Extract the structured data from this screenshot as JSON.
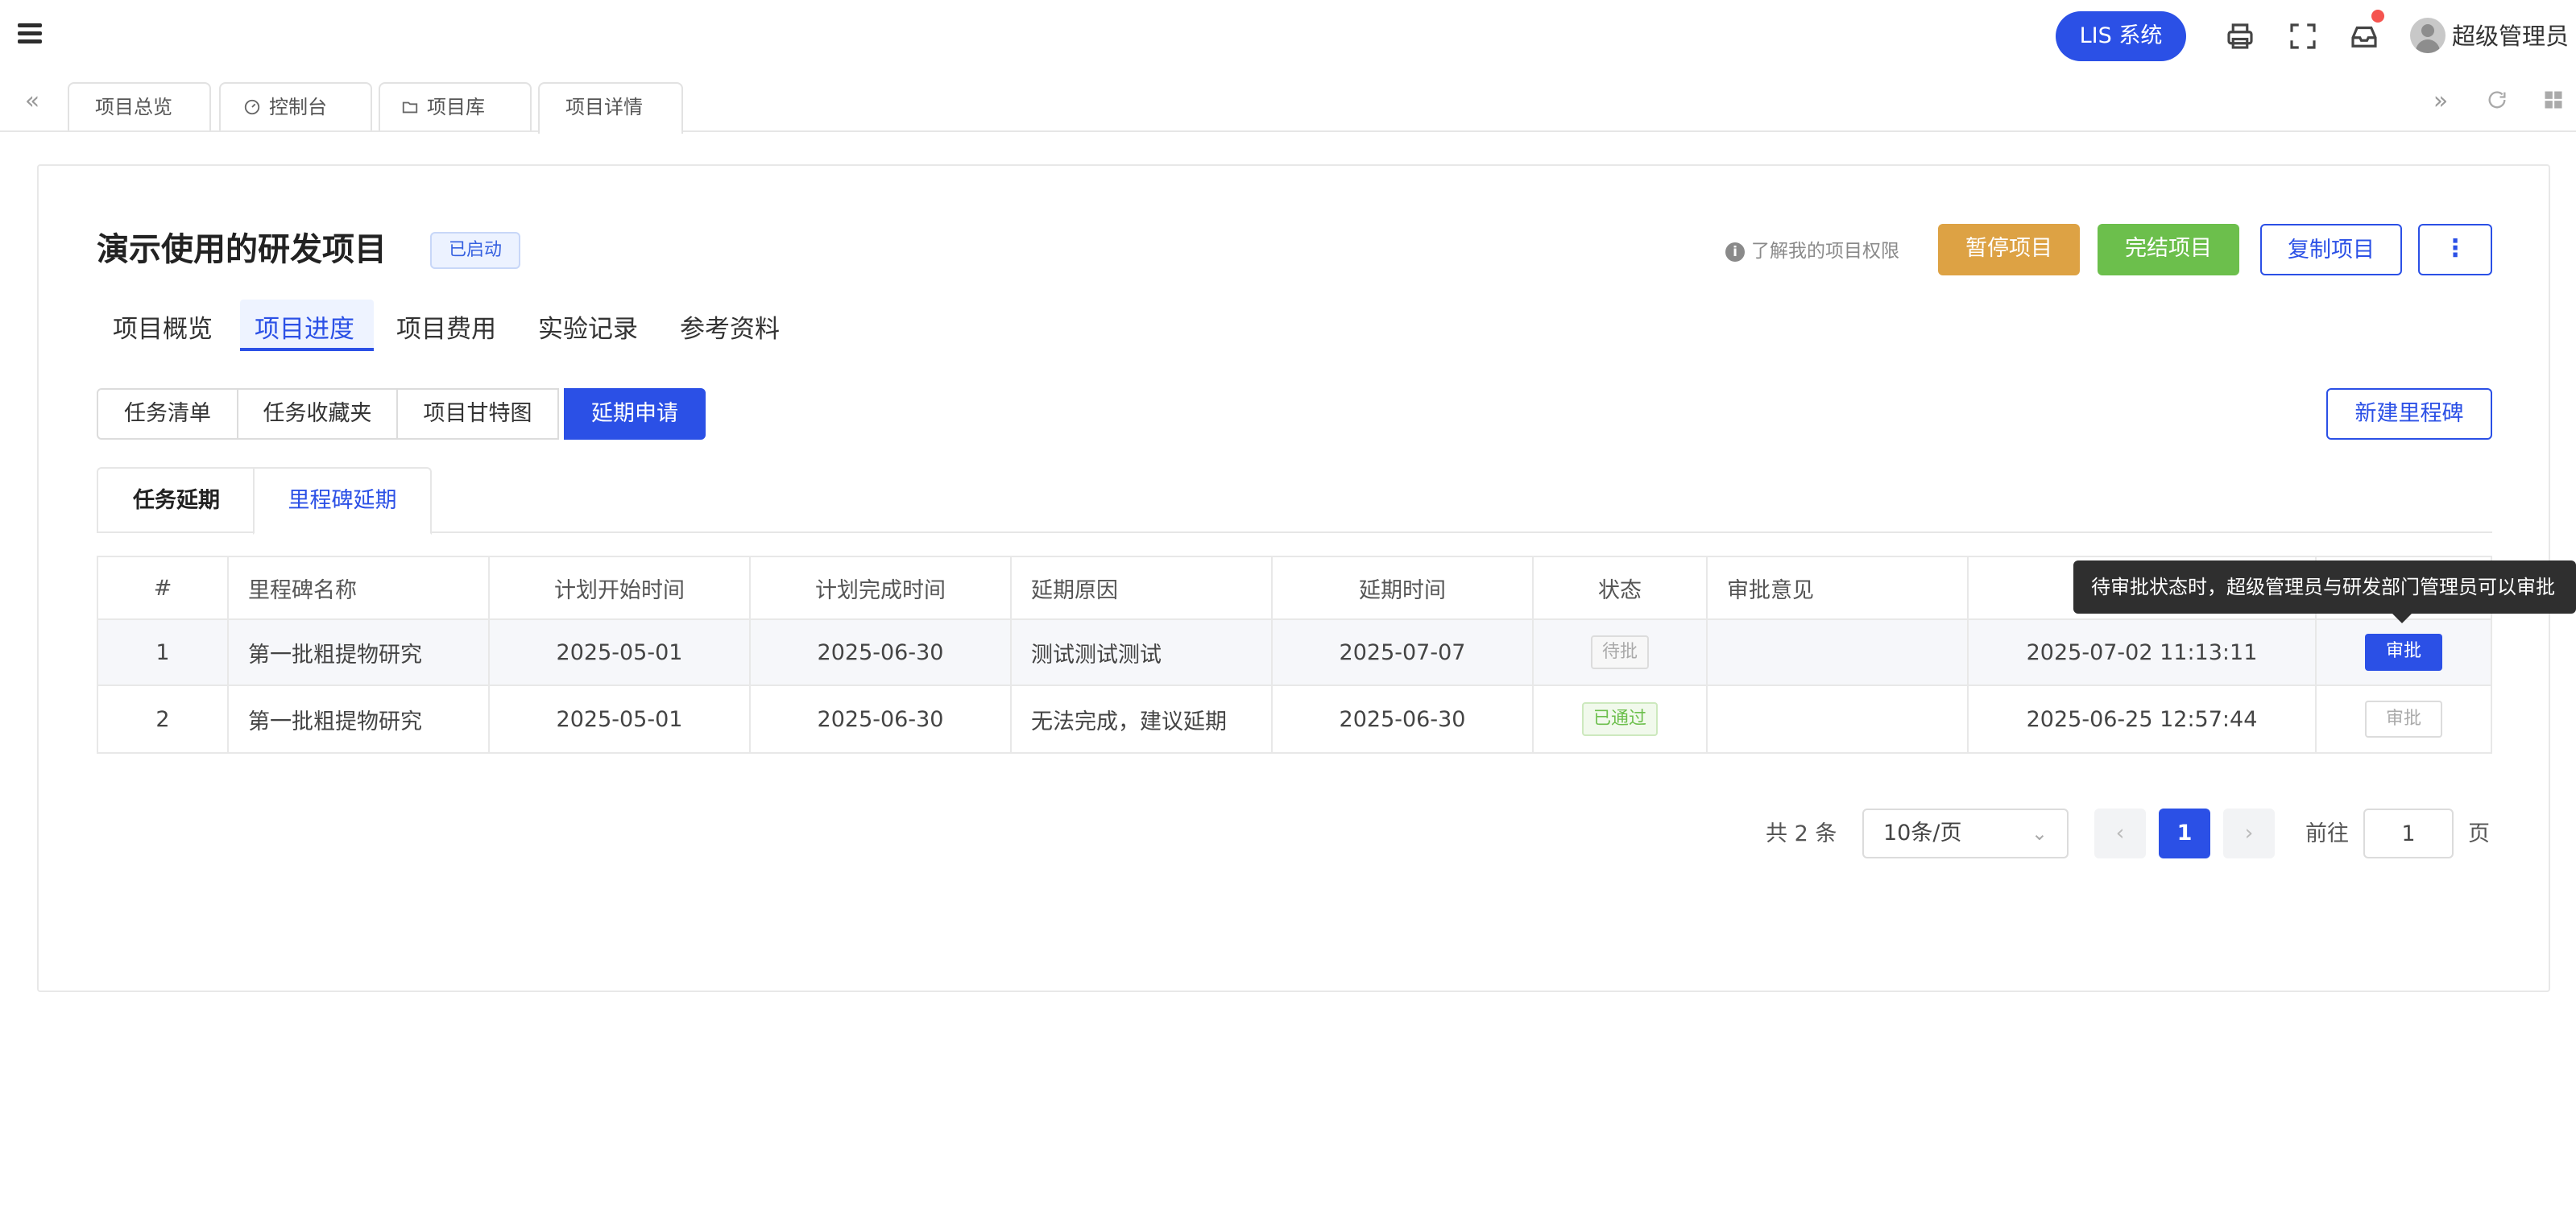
{
  "header": {
    "system_button": "LIS 系统",
    "username": "超级管理员",
    "colors": {
      "primary": "#2b50e6",
      "notification_dot": "#f5544f"
    }
  },
  "page_tabs": [
    {
      "label": "项目总览",
      "icon": ""
    },
    {
      "label": "控制台",
      "icon": "dashboard-icon"
    },
    {
      "label": "项目库",
      "icon": "folder-icon"
    },
    {
      "label": "项目详情",
      "icon": ""
    }
  ],
  "project": {
    "title": "演示使用的研发项目",
    "status_badge": "已启动",
    "permission_link": "了解我的项目权限",
    "actions": {
      "pause": "暂停项目",
      "finish": "完结项目",
      "copy": "复制项目",
      "more": "⋮"
    },
    "action_colors": {
      "pause": "#dda244",
      "finish": "#6cbf4c"
    }
  },
  "main_tabs": [
    "项目概览",
    "项目进度",
    "项目费用",
    "实验记录",
    "参考资料"
  ],
  "segments": [
    "任务清单",
    "任务收藏夹",
    "项目甘特图",
    "延期申请"
  ],
  "new_milestone_button": "新建里程碑",
  "sub_tabs": [
    "任务延期",
    "里程碑延期"
  ],
  "table": {
    "columns": [
      "#",
      "里程碑名称",
      "计划开始时间",
      "计划完成时间",
      "延期原因",
      "延期时间",
      "状态",
      "审批意见",
      "",
      ""
    ],
    "rows": [
      {
        "index": "1",
        "name": "第一批粗提物研究",
        "plan_start": "2025-05-01",
        "plan_end": "2025-06-30",
        "reason": "测试测试测试",
        "delay_date": "2025-07-07",
        "status": "待批",
        "opinion": "",
        "time": "2025-07-02 11:13:11",
        "action": "审批"
      },
      {
        "index": "2",
        "name": "第一批粗提物研究",
        "plan_start": "2025-05-01",
        "plan_end": "2025-06-30",
        "reason": "无法完成，建议延期",
        "delay_date": "2025-06-30",
        "status": "已通过",
        "opinion": "",
        "time": "2025-06-25 12:57:44",
        "action": "审批"
      }
    ]
  },
  "tooltip": "待审批状态时，超级管理员与研发部门管理员可以审批",
  "pagination": {
    "total": "共 2 条",
    "page_size": "10条/页",
    "current_page": "1",
    "goto_label": "前往",
    "goto_value": "1",
    "goto_unit": "页"
  }
}
